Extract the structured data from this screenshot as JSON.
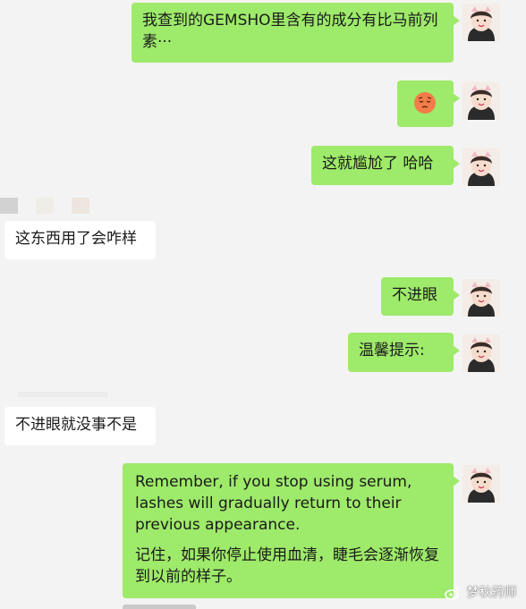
{
  "messages": [
    {
      "from": "me",
      "text": "我查到的GEMSHO里含有的成分有比马前列素···"
    },
    {
      "from": "me",
      "emoji": "pensive-face-emoji"
    },
    {
      "from": "me",
      "text": "这就尴尬了 哈哈"
    },
    {
      "from": "other",
      "text": "这东西用了会咋样"
    },
    {
      "from": "me",
      "text": "不进眼"
    },
    {
      "from": "me",
      "text": "温馨提示:"
    },
    {
      "from": "other",
      "text": "不进眼就没事不是"
    },
    {
      "from": "me",
      "text_en": "Remember, if you stop using serum, lashes will gradually return to their previous appearance.",
      "text_zh": "记住，如果你停止使用血清，睫毛会逐渐恢复到以前的样子。"
    }
  ],
  "watermark": "梦秋药师",
  "colors": {
    "my_bubble": "#9eea6a",
    "other_bubble": "#ffffff",
    "background": "#f3f3f3"
  }
}
